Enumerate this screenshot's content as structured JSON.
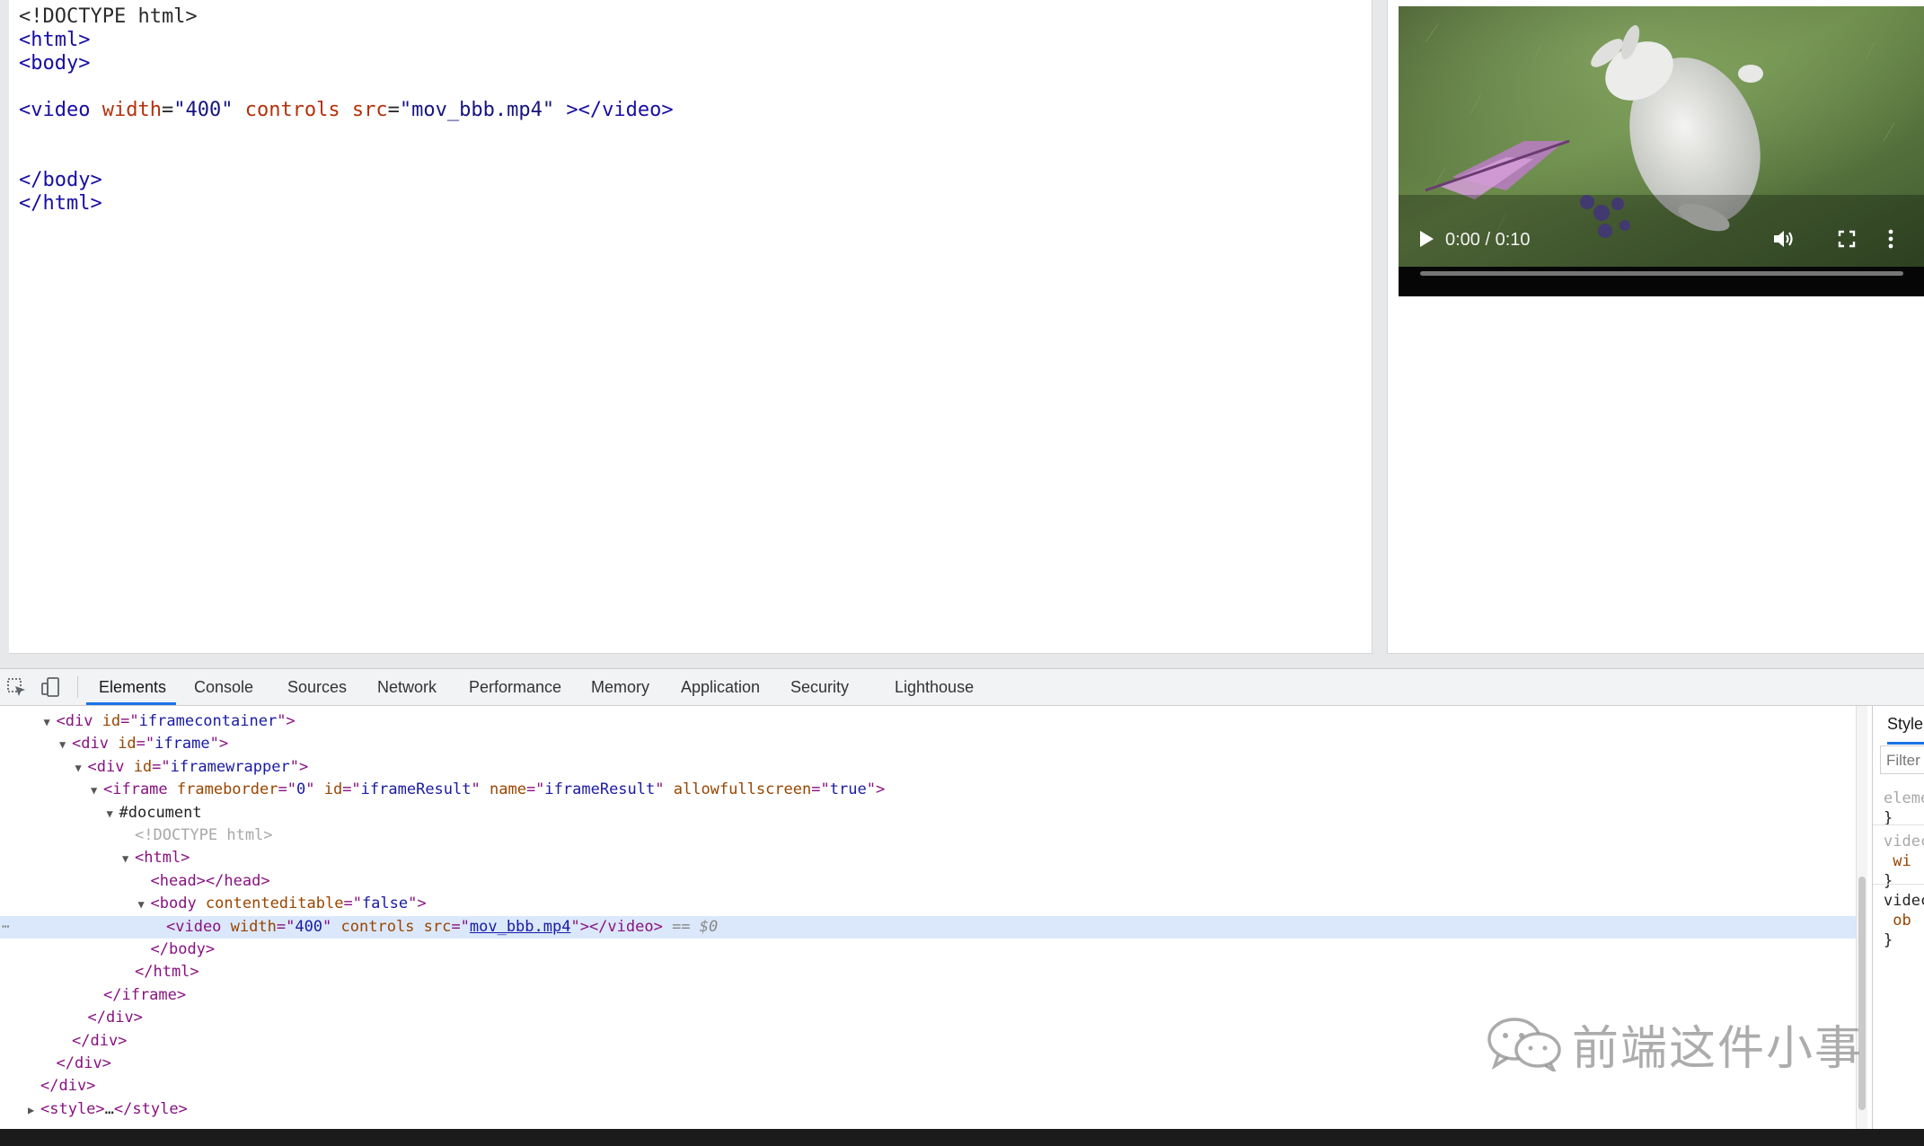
{
  "editor": {
    "lines": [
      [
        {
          "c": "t-plain",
          "t": "<!DOCTYPE html>"
        }
      ],
      [
        {
          "c": "t-tag",
          "t": "<html>"
        }
      ],
      [
        {
          "c": "t-tag",
          "t": "<body>"
        }
      ],
      [],
      [
        {
          "c": "t-tag",
          "t": "<video"
        },
        {
          "c": "t-plain",
          "t": " "
        },
        {
          "c": "t-attr",
          "t": "width"
        },
        {
          "c": "t-plain",
          "t": "="
        },
        {
          "c": "t-val",
          "t": "\"400\""
        },
        {
          "c": "t-plain",
          "t": " "
        },
        {
          "c": "t-attr",
          "t": "controls"
        },
        {
          "c": "t-plain",
          "t": " "
        },
        {
          "c": "t-attr",
          "t": "src"
        },
        {
          "c": "t-plain",
          "t": "="
        },
        {
          "c": "t-val",
          "t": "\"mov_bbb.mp4\""
        },
        {
          "c": "t-plain",
          "t": " "
        },
        {
          "c": "t-tag",
          "t": "></video>"
        }
      ],
      [],
      [],
      [
        {
          "c": "t-tag",
          "t": "</body>"
        }
      ],
      [
        {
          "c": "t-tag",
          "t": "</html>"
        }
      ]
    ]
  },
  "video_player": {
    "time": "0:00 / 0:10",
    "progress_fraction": 0.0,
    "controls": [
      "play-icon",
      "volume-icon",
      "fullscreen-icon",
      "more-vertical-icon"
    ]
  },
  "devtools": {
    "tabs": [
      "Elements",
      "Console",
      "Sources",
      "Network",
      "Performance",
      "Memory",
      "Application",
      "Security",
      "Lighthouse"
    ],
    "active_tab": "Elements",
    "tree": [
      {
        "indent": 3,
        "arrow": "open",
        "parts": [
          {
            "c": "e-tag",
            "t": "<div "
          },
          {
            "c": "e-attr",
            "t": "id"
          },
          {
            "c": "e-tag",
            "t": "=\""
          },
          {
            "c": "e-val",
            "t": "iframecontainer"
          },
          {
            "c": "e-tag",
            "t": "\">"
          }
        ]
      },
      {
        "indent": 4,
        "arrow": "open",
        "parts": [
          {
            "c": "e-tag",
            "t": "<div "
          },
          {
            "c": "e-attr",
            "t": "id"
          },
          {
            "c": "e-tag",
            "t": "=\""
          },
          {
            "c": "e-val",
            "t": "iframe"
          },
          {
            "c": "e-tag",
            "t": "\">"
          }
        ]
      },
      {
        "indent": 5,
        "arrow": "open",
        "parts": [
          {
            "c": "e-tag",
            "t": "<div "
          },
          {
            "c": "e-attr",
            "t": "id"
          },
          {
            "c": "e-tag",
            "t": "=\""
          },
          {
            "c": "e-val",
            "t": "iframewrapper"
          },
          {
            "c": "e-tag",
            "t": "\">"
          }
        ]
      },
      {
        "indent": 6,
        "arrow": "open",
        "parts": [
          {
            "c": "e-tag",
            "t": "<iframe "
          },
          {
            "c": "e-attr",
            "t": "frameborder"
          },
          {
            "c": "e-tag",
            "t": "=\""
          },
          {
            "c": "e-val",
            "t": "0"
          },
          {
            "c": "e-tag",
            "t": "\" "
          },
          {
            "c": "e-attr",
            "t": "id"
          },
          {
            "c": "e-tag",
            "t": "=\""
          },
          {
            "c": "e-val",
            "t": "iframeResult"
          },
          {
            "c": "e-tag",
            "t": "\" "
          },
          {
            "c": "e-attr",
            "t": "name"
          },
          {
            "c": "e-tag",
            "t": "=\""
          },
          {
            "c": "e-val",
            "t": "iframeResult"
          },
          {
            "c": "e-tag",
            "t": "\" "
          },
          {
            "c": "e-attr",
            "t": "allowfullscreen"
          },
          {
            "c": "e-tag",
            "t": "=\""
          },
          {
            "c": "e-val",
            "t": "true"
          },
          {
            "c": "e-tag",
            "t": "\">"
          }
        ]
      },
      {
        "indent": 7,
        "arrow": "open",
        "parts": [
          {
            "c": "e-plain",
            "t": "#document"
          }
        ]
      },
      {
        "indent": 8,
        "arrow": "",
        "parts": [
          {
            "c": "e-dim",
            "t": "<!DOCTYPE html>"
          }
        ]
      },
      {
        "indent": 8,
        "arrow": "open",
        "parts": [
          {
            "c": "e-tag",
            "t": "<html>"
          }
        ]
      },
      {
        "indent": 9,
        "arrow": "",
        "parts": [
          {
            "c": "e-tag",
            "t": "<head></head>"
          }
        ]
      },
      {
        "indent": 9,
        "arrow": "open",
        "parts": [
          {
            "c": "e-tag",
            "t": "<body "
          },
          {
            "c": "e-attr",
            "t": "contenteditable"
          },
          {
            "c": "e-tag",
            "t": "=\""
          },
          {
            "c": "e-val",
            "t": "false"
          },
          {
            "c": "e-tag",
            "t": "\">"
          }
        ]
      },
      {
        "indent": 10,
        "arrow": "",
        "selected": true,
        "parts": [
          {
            "c": "e-tag",
            "t": "<video "
          },
          {
            "c": "e-attr",
            "t": "width"
          },
          {
            "c": "e-tag",
            "t": "=\""
          },
          {
            "c": "e-val",
            "t": "400"
          },
          {
            "c": "e-tag",
            "t": "\" "
          },
          {
            "c": "e-attr",
            "t": "controls"
          },
          {
            "c": "e-tag",
            "t": " "
          },
          {
            "c": "e-attr",
            "t": "src"
          },
          {
            "c": "e-tag",
            "t": "=\""
          },
          {
            "c": "e-link",
            "t": "mov_bbb.mp4"
          },
          {
            "c": "e-tag",
            "t": "\"></video>"
          },
          {
            "c": "e-sel",
            "t": " == $0"
          }
        ]
      },
      {
        "indent": 9,
        "arrow": "",
        "parts": [
          {
            "c": "e-tag",
            "t": "</body>"
          }
        ]
      },
      {
        "indent": 8,
        "arrow": "",
        "parts": [
          {
            "c": "e-tag",
            "t": "</html>"
          }
        ]
      },
      {
        "indent": 6,
        "arrow": "",
        "parts": [
          {
            "c": "e-tag",
            "t": "</iframe>"
          }
        ]
      },
      {
        "indent": 5,
        "arrow": "",
        "parts": [
          {
            "c": "e-tag",
            "t": "</div>"
          }
        ]
      },
      {
        "indent": 4,
        "arrow": "",
        "parts": [
          {
            "c": "e-tag",
            "t": "</div>"
          }
        ]
      },
      {
        "indent": 3,
        "arrow": "",
        "parts": [
          {
            "c": "e-tag",
            "t": "</div>"
          }
        ]
      },
      {
        "indent": 2,
        "arrow": "",
        "parts": [
          {
            "c": "e-tag",
            "t": "</div>"
          }
        ]
      },
      {
        "indent": 2,
        "arrow": "closed",
        "parts": [
          {
            "c": "e-tag",
            "t": "<style>"
          },
          {
            "c": "e-plain",
            "t": "…"
          },
          {
            "c": "e-tag",
            "t": "</style>"
          }
        ]
      }
    ],
    "styles": {
      "tab": "Style",
      "filter": "Filter",
      "lines": [
        {
          "c": "e-dim",
          "t": "eleme"
        },
        {
          "c": "e-plain",
          "t": "}"
        },
        {
          "c": "e-dim",
          "t": "videc"
        },
        {
          "c": "e-attr",
          "t": " wi"
        },
        {
          "c": "e-plain",
          "t": "}"
        },
        {
          "c": "e-plain",
          "t": "videc"
        },
        {
          "c": "e-attr",
          "t": " ob"
        },
        {
          "c": "e-plain",
          "t": "}"
        }
      ]
    }
  },
  "watermark": {
    "icon": "wechat-icon",
    "text": "前端这件小事"
  }
}
